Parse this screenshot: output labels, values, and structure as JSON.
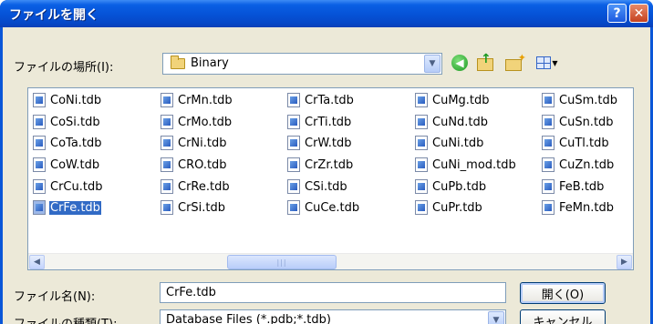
{
  "window": {
    "title": "ファイルを開く",
    "help_label": "?",
    "close_label": "✕"
  },
  "look_in": {
    "label": "ファイルの場所(I):",
    "value": "Binary"
  },
  "toolbar": {
    "back_icon": "back-icon",
    "up_icon": "up-folder-icon",
    "new_folder_icon": "new-folder-icon",
    "view_menu_icon": "view-menu-icon"
  },
  "files": {
    "columns": [
      [
        "CoNi.tdb",
        "CoSi.tdb",
        "CoTa.tdb",
        "CoW.tdb",
        "CrCu.tdb",
        "CrFe.tdb"
      ],
      [
        "CrMn.tdb",
        "CrMo.tdb",
        "CrNi.tdb",
        "CRO.tdb",
        "CrRe.tdb",
        "CrSi.tdb"
      ],
      [
        "CrTa.tdb",
        "CrTi.tdb",
        "CrW.tdb",
        "CrZr.tdb",
        "CSi.tdb",
        "CuCe.tdb"
      ],
      [
        "CuMg.tdb",
        "CuNd.tdb",
        "CuNi.tdb",
        "CuNi_mod.tdb",
        "CuPb.tdb",
        "CuPr.tdb"
      ],
      [
        "CuSm.tdb",
        "CuSn.tdb",
        "CuTl.tdb",
        "CuZn.tdb",
        "FeB.tdb",
        "FeMn.tdb"
      ]
    ],
    "selected": "CrFe.tdb"
  },
  "scrollbar": {
    "left_arrow": "◀",
    "right_arrow": "▶",
    "thumb_grip": "|||"
  },
  "filename": {
    "label": "ファイル名(N):",
    "value": "CrFe.tdb"
  },
  "filetype": {
    "label": "ファイルの種類(T):",
    "value": "Database Files (*.pdb;*.tdb)"
  },
  "buttons": {
    "open_label": "開く(O)",
    "cancel_label": "キャンセル"
  },
  "colors": {
    "title_bar": "#0552d6",
    "selection": "#316ac5",
    "dialog_face": "#ece9d8"
  }
}
